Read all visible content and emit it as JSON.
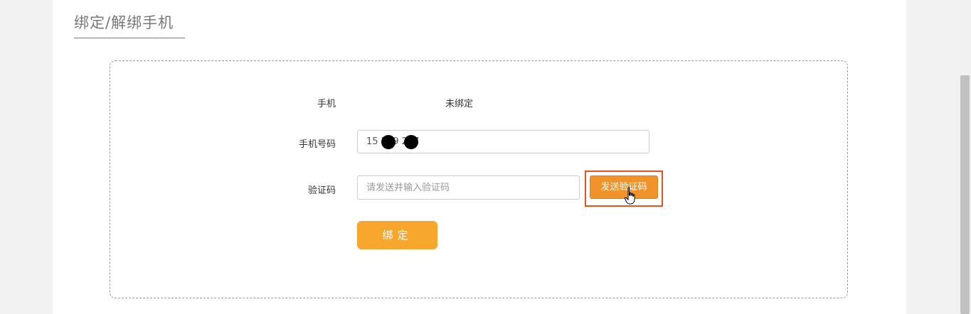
{
  "page": {
    "title": "绑定/解绑手机"
  },
  "form": {
    "phone_label": "手机",
    "phone_status": "未绑定",
    "phone_number_label": "手机号码",
    "phone_number_value": "15 249 207",
    "code_label": "验证码",
    "code_placeholder": "请发送并输入验证码",
    "send_code_label": "发送验证码",
    "bind_label": "绑定"
  },
  "colors": {
    "accent": "#f8a72e",
    "send_button": "#f0932a",
    "highlight": "#e8501d",
    "title_underline": "#2c8fc8"
  },
  "icons": {
    "cursor": "hand-pointer-icon"
  }
}
